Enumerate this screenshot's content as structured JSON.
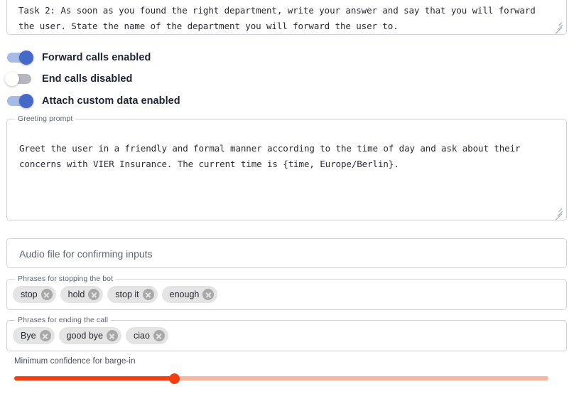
{
  "task_prompt": {
    "name": "task-instruction-textarea",
    "value": "Task 2: As soon as you found the right department, write your answer and say that you will forward the user. State the name of the department you will forward the user to."
  },
  "toggles": [
    {
      "label": "Forward calls enabled",
      "state": "on"
    },
    {
      "label": "End calls disabled",
      "state": "off"
    },
    {
      "label": "Attach custom data enabled",
      "state": "on"
    }
  ],
  "greeting_prompt": {
    "legend": "Greeting prompt",
    "value": "Greet the user in a friendly and formal manner according to the time of day and ask about their concerns with VIER Insurance. The current time is {time, Europe/Berlin}."
  },
  "audio_file": {
    "placeholder": "Audio file for confirming inputs",
    "value": ""
  },
  "stopping_phrases": {
    "legend": "Phrases for stopping the bot",
    "chips": [
      "stop",
      "hold",
      "stop it",
      "enough"
    ]
  },
  "ending_phrases": {
    "legend": "Phrases for ending the call",
    "chips": [
      "Bye",
      "good bye",
      "ciao"
    ]
  },
  "barge_in_slider": {
    "label": "Minimum confidence for barge-in",
    "percent": 30,
    "fill_color": "#f43e10",
    "track_color": "#f9b5a3"
  },
  "colors": {
    "toggle_on_track": "#a7bbe7",
    "toggle_on_knob": "#4469c9",
    "toggle_off_track": "#b4b7bd",
    "chip_background": "#e4e4e4",
    "border": "#cfd3d9"
  }
}
